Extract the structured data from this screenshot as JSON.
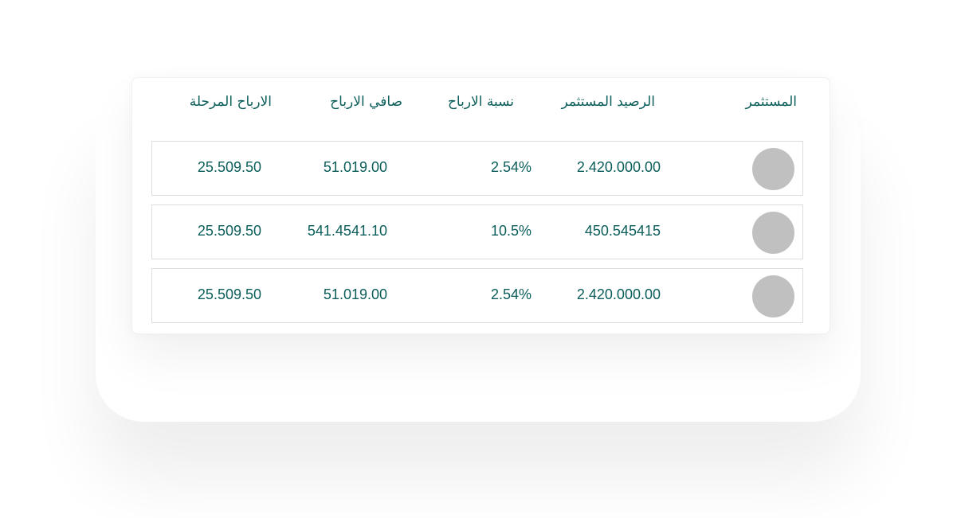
{
  "table": {
    "headers": {
      "investor": "المستثمر",
      "invested_balance": "الرصيد المستثمر",
      "profit_rate": "نسبة الارباح",
      "net_profit": "صافي الارباح",
      "carried_profit": "الارباح المرحلة"
    },
    "rows": [
      {
        "invested_balance": "2.420.000.00",
        "profit_rate": "2.54%",
        "net_profit": "51.019.00",
        "carried_profit": "25.509.50"
      },
      {
        "invested_balance": "450.545415",
        "profit_rate": "10.5%",
        "net_profit": "541.4541.10",
        "carried_profit": "25.509.50"
      },
      {
        "invested_balance": "2.420.000.00",
        "profit_rate": "2.54%",
        "net_profit": "51.019.00",
        "carried_profit": "25.509.50"
      }
    ]
  },
  "colors": {
    "text": "#0b5e5a",
    "avatar": "#c0c0c0",
    "row_border": "#dedede"
  }
}
